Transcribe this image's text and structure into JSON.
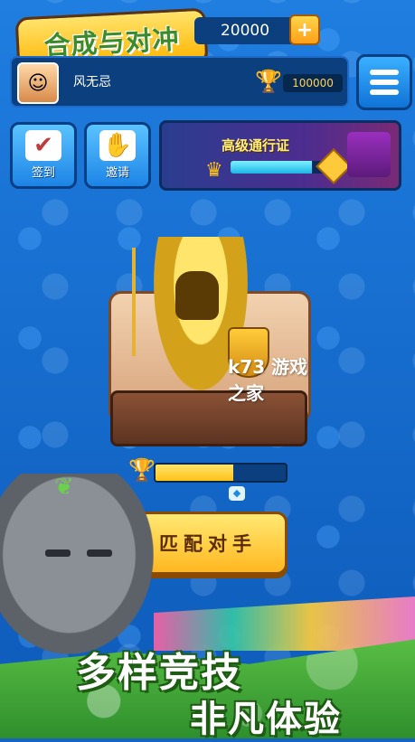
{
  "header": {
    "logo_text": "合成与对冲",
    "coins": "20000",
    "coin_add_label": "+"
  },
  "profile": {
    "username": "风无忌",
    "trophies": "100000",
    "avatar_icon": "character-avatar",
    "trophy_icon": "trophy-icon"
  },
  "side_buttons": [
    {
      "label": "签到",
      "icon": "calendar-icon"
    },
    {
      "label": "邀请",
      "icon": "handshake-icon"
    }
  ],
  "battle_pass": {
    "title": "高级通行证",
    "progress": 0.75
  },
  "arena": {
    "watermark": "k73 游戏之家"
  },
  "rank_progress": {
    "fraction": 0.6
  },
  "match_button": {
    "label": "匹配对手"
  },
  "slogan": {
    "line1": "多样竞技",
    "line2": "非凡体验"
  },
  "colors": {
    "background": "#1565c0",
    "accent_gold": "#ffc21a",
    "button_blue": "#1d84e6",
    "slogan_outline": "#1d5c12"
  }
}
